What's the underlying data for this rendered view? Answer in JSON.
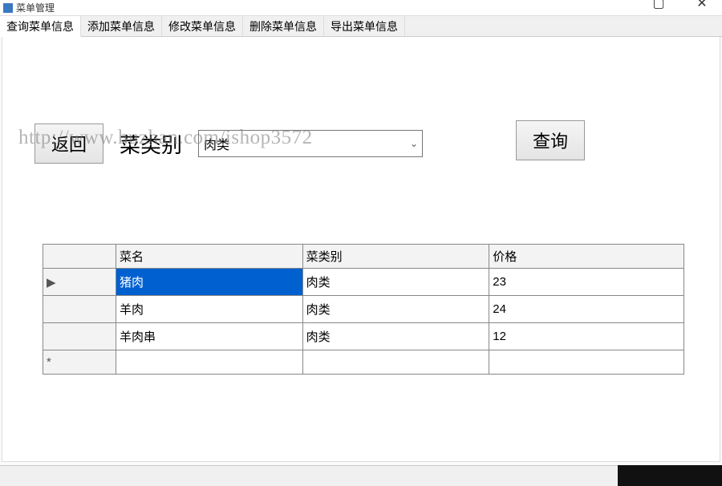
{
  "window": {
    "title": "菜单管理"
  },
  "tabs": [
    {
      "label": "查询菜单信息",
      "active": true
    },
    {
      "label": "添加菜单信息",
      "active": false
    },
    {
      "label": "修改菜单信息",
      "active": false
    },
    {
      "label": "删除菜单信息",
      "active": false
    },
    {
      "label": "导出菜单信息",
      "active": false
    }
  ],
  "form": {
    "back_label": "返回",
    "category_label": "菜类别",
    "category_value": "肉类",
    "query_label": "查询"
  },
  "watermark": "http://www.huzhan.com/ishop3572",
  "grid": {
    "columns": {
      "name": "菜名",
      "category": "菜类别",
      "price": "价格"
    },
    "rows": [
      {
        "indicator": "▶",
        "name": "猪肉",
        "category": "肉类",
        "price": "23",
        "selected": true
      },
      {
        "indicator": "",
        "name": "羊肉",
        "category": "肉类",
        "price": "24",
        "selected": false
      },
      {
        "indicator": "",
        "name": "羊肉串",
        "category": "肉类",
        "price": "12",
        "selected": false
      },
      {
        "indicator": "*",
        "name": "",
        "category": "",
        "price": "",
        "selected": false
      }
    ]
  }
}
